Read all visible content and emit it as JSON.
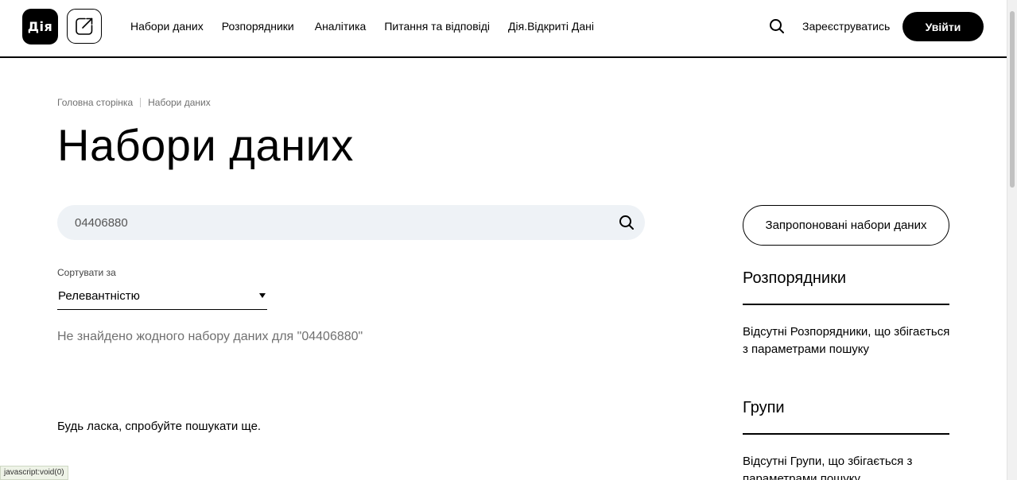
{
  "header": {
    "logo_text": "Дія",
    "nav": [
      "Набори даних",
      "Розпорядники",
      "Аналітика",
      "Питання та відповіді",
      "Дія.Відкриті Дані"
    ],
    "register_label": "Зареєструватись",
    "login_label": "Увійти"
  },
  "breadcrumb": [
    "Головна сторінка",
    "Набори даних"
  ],
  "page_title": "Набори даних",
  "search": {
    "value": "04406880"
  },
  "sort": {
    "label": "Сортувати за",
    "value": "Релевантністю"
  },
  "results": {
    "no_results": "Не знайдено жодного набору даних для \"04406880\"",
    "try_again": "Будь ласка, спробуйте пошукати ще."
  },
  "sidebar": {
    "suggest_button": "Запропоновані набори даних",
    "managers_heading": "Розпорядники",
    "managers_empty": "Відсутні Розпорядники, що збігається з параметрами пошуку",
    "groups_heading": "Групи",
    "groups_empty": "Відсутні Групи, що збігається з параметрами пошуку"
  },
  "status_bar": "javascript:void(0)"
}
